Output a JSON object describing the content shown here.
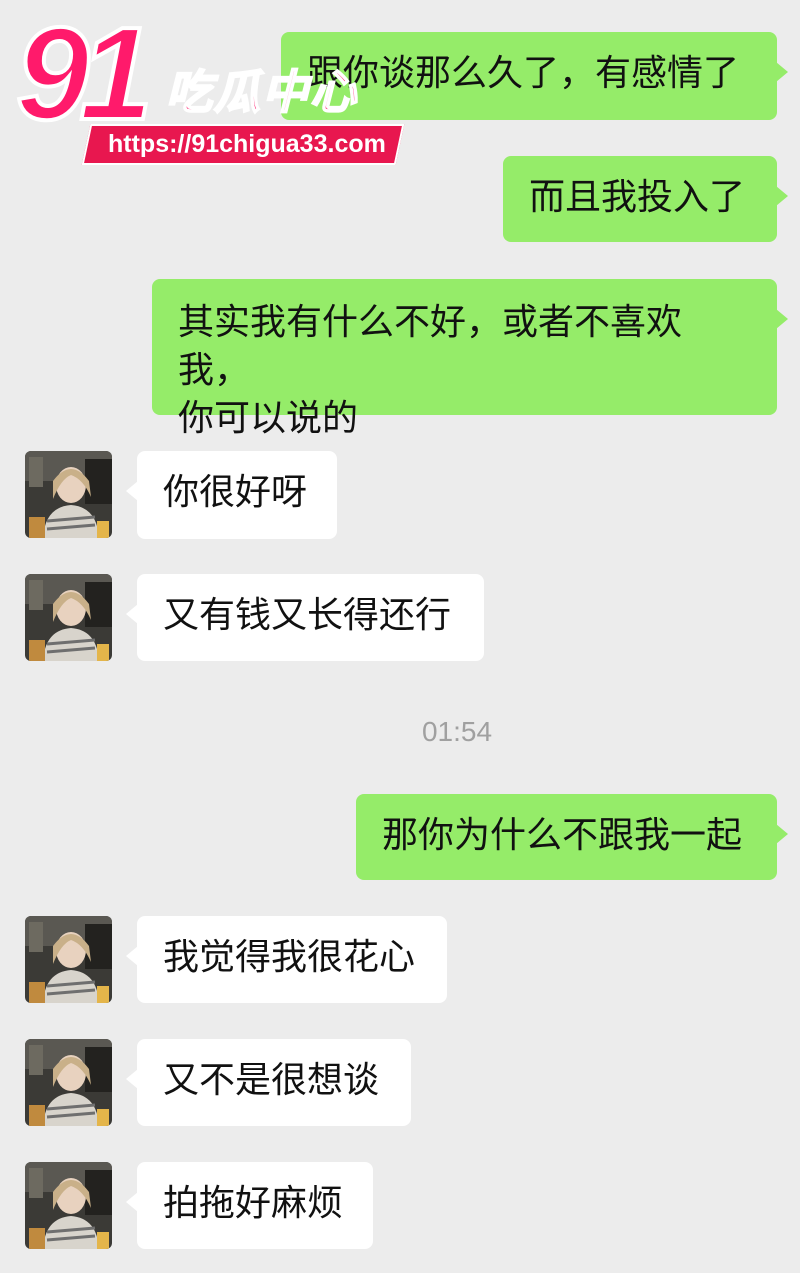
{
  "chat": {
    "messages": [
      {
        "side": "sent",
        "text": "跟你谈那么久了，有感情了"
      },
      {
        "side": "sent",
        "text": "而且我投入了"
      },
      {
        "side": "sent",
        "lines": [
          "其实我有什么不好，或者不喜欢我，",
          "你可以说的"
        ]
      },
      {
        "side": "recv",
        "text": "你很好呀"
      },
      {
        "side": "recv",
        "text": "又有钱又长得还行"
      },
      {
        "side": "sent",
        "text": "那你为什么不跟我一起"
      },
      {
        "side": "recv",
        "text": "我觉得我很花心"
      },
      {
        "side": "recv",
        "text": "又不是很想谈"
      },
      {
        "side": "recv",
        "text": "拍拖好麻烦"
      }
    ],
    "timestamp": "01:54"
  },
  "watermark": {
    "number": "91",
    "name": "吃瓜中心",
    "url": "https://91chigua33.com"
  },
  "colors": {
    "background": "#ececec",
    "sent_bubble": "#95ec69",
    "received_bubble": "#ffffff",
    "watermark": "#ff1a6b"
  },
  "icons": {
    "contact_avatar": "woman-at-cafe-photo-avatar"
  }
}
